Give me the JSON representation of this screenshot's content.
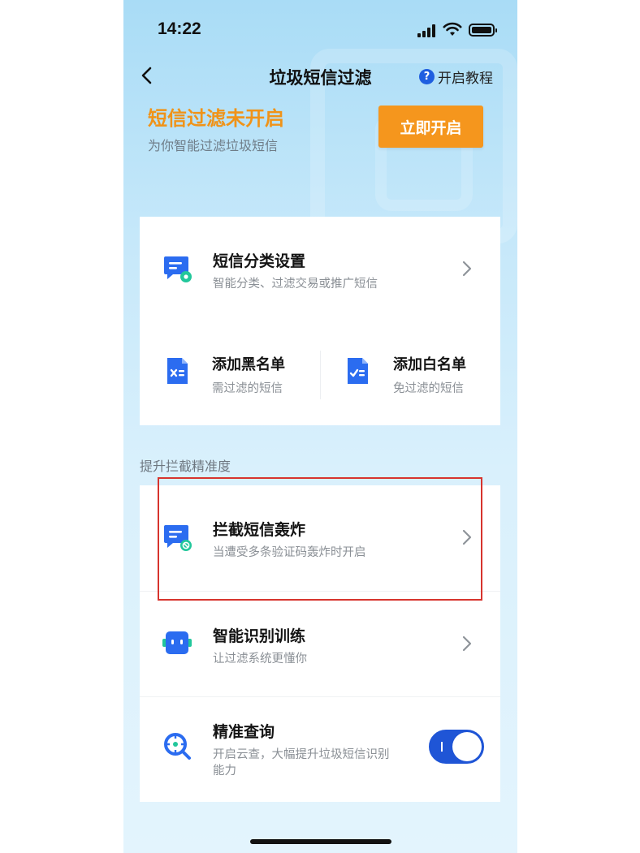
{
  "status_bar": {
    "time": "14:22"
  },
  "nav": {
    "title": "垃圾短信过滤",
    "tutorial_label": "开启教程"
  },
  "hero": {
    "title": "短信过滤未开启",
    "subtitle": "为你智能过滤垃圾短信",
    "enable_button": "立即开启"
  },
  "classification": {
    "title": "短信分类设置",
    "subtitle": "智能分类、过滤交易或推广短信"
  },
  "blacklist": {
    "title": "添加黑名单",
    "subtitle": "需过滤的短信"
  },
  "whitelist": {
    "title": "添加白名单",
    "subtitle": "免过滤的短信"
  },
  "section_label": "提升拦截精准度",
  "bombing": {
    "title": "拦截短信轰炸",
    "subtitle": "当遭受多条验证码轰炸时开启"
  },
  "training": {
    "title": "智能识别训练",
    "subtitle": "让过滤系统更懂你"
  },
  "precise": {
    "title": "精准查询",
    "subtitle_line1": "开启云查，大幅提升垃圾短信识别",
    "subtitle_line2": "能力",
    "toggle_on": true
  },
  "colors": {
    "accent_blue": "#1f55d6",
    "orange": "#f5961d",
    "highlight_red": "#d7342e"
  }
}
